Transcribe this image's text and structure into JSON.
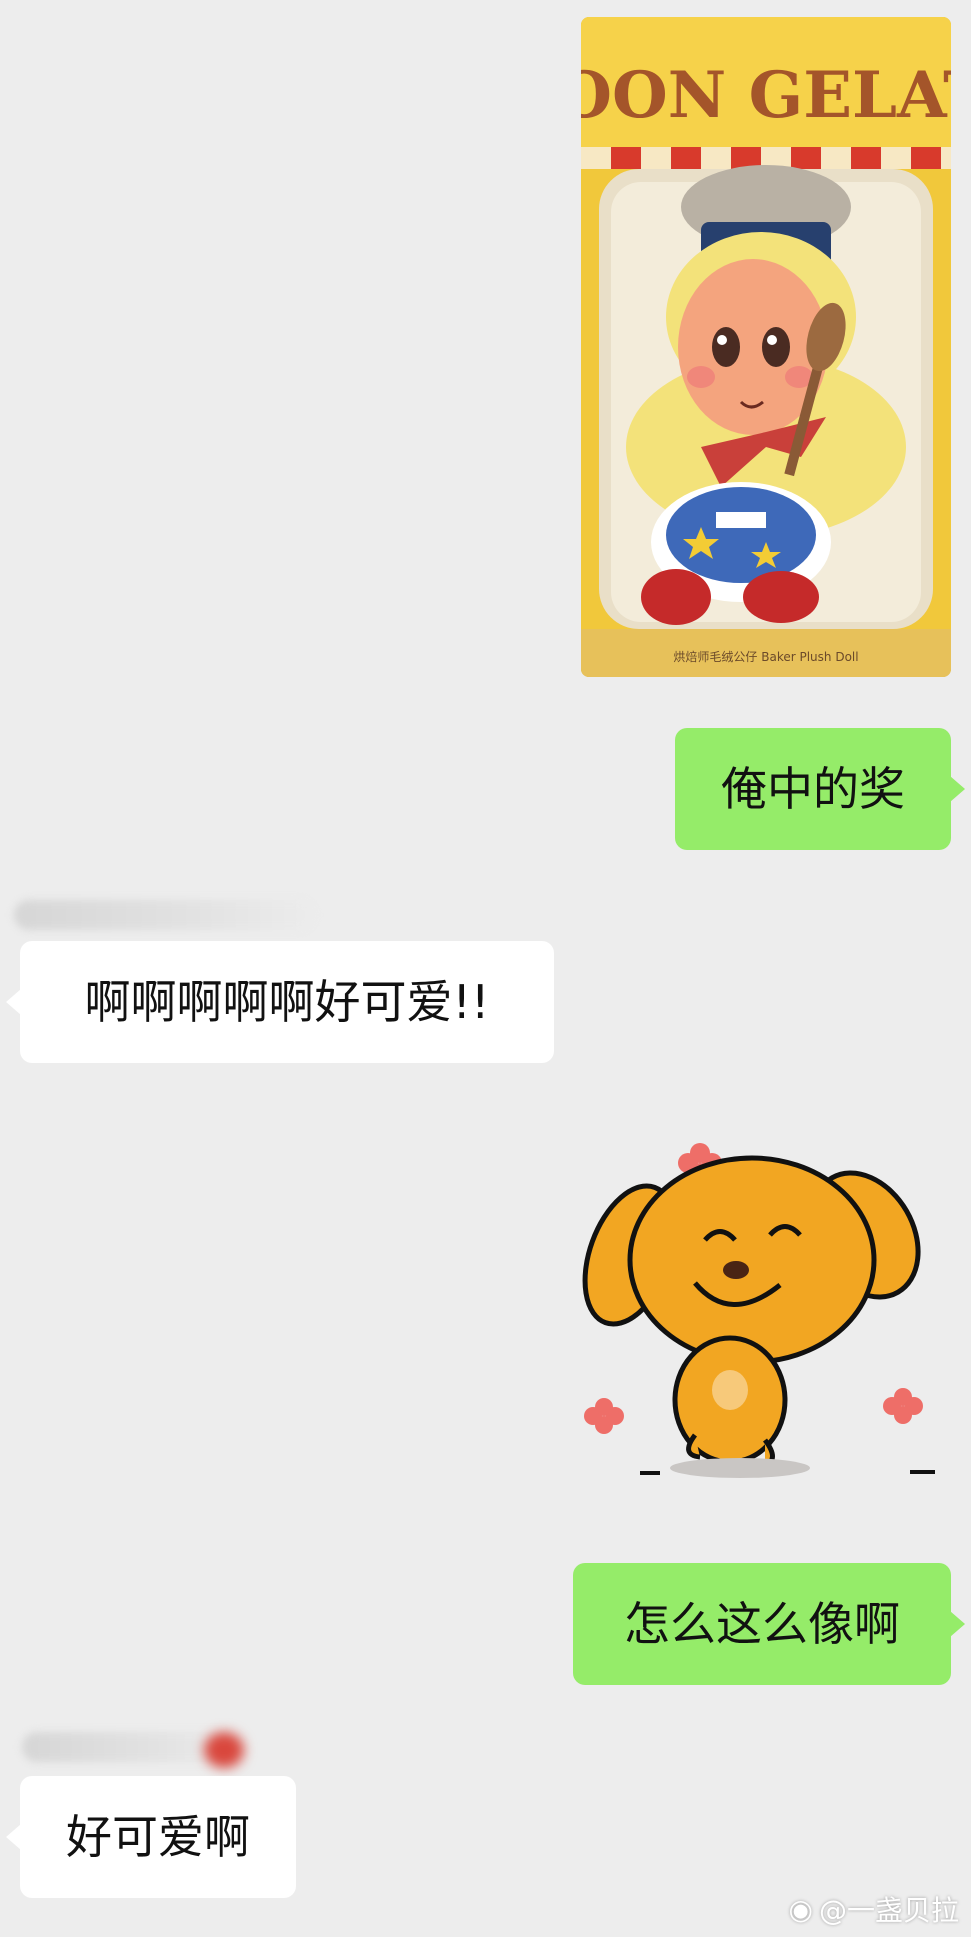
{
  "messages": [
    {
      "type": "image",
      "side": "right",
      "box_text": "MOON GELATO",
      "box_caption": "烘焙师毛绒公仔 Baker Plush Doll"
    },
    {
      "type": "text",
      "side": "right",
      "text": "俺中的奖"
    },
    {
      "type": "text",
      "side": "left",
      "text": "啊啊啊啊啊好可爱!!"
    },
    {
      "type": "sticker",
      "side": "right",
      "sticker": "smiling-orange-dog"
    },
    {
      "type": "text",
      "side": "right",
      "text": "怎么这么像啊"
    },
    {
      "type": "text",
      "side": "left",
      "text": "好可爱啊"
    }
  ],
  "watermark": {
    "icon": "weibo-icon",
    "text": "@一盏贝拉"
  },
  "colors": {
    "background": "#ededed",
    "outgoing_bubble": "#95ec69",
    "incoming_bubble": "#ffffff",
    "dog": "#f2a622"
  }
}
